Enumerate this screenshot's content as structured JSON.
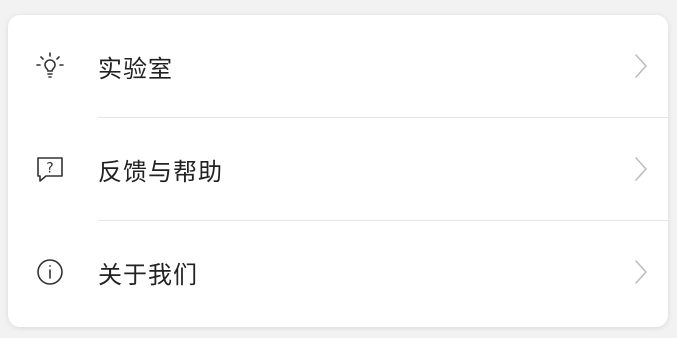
{
  "settings_list": {
    "items": [
      {
        "label": "实验室",
        "icon": "lightbulb-icon"
      },
      {
        "label": "反馈与帮助",
        "icon": "help-chat-icon"
      },
      {
        "label": "关于我们",
        "icon": "info-icon"
      }
    ]
  },
  "colors": {
    "text": "#222222",
    "icon": "#333333",
    "chevron": "#bdbdbd",
    "divider": "#e6e6e6",
    "background": "#f2f2f2",
    "card": "#ffffff"
  }
}
